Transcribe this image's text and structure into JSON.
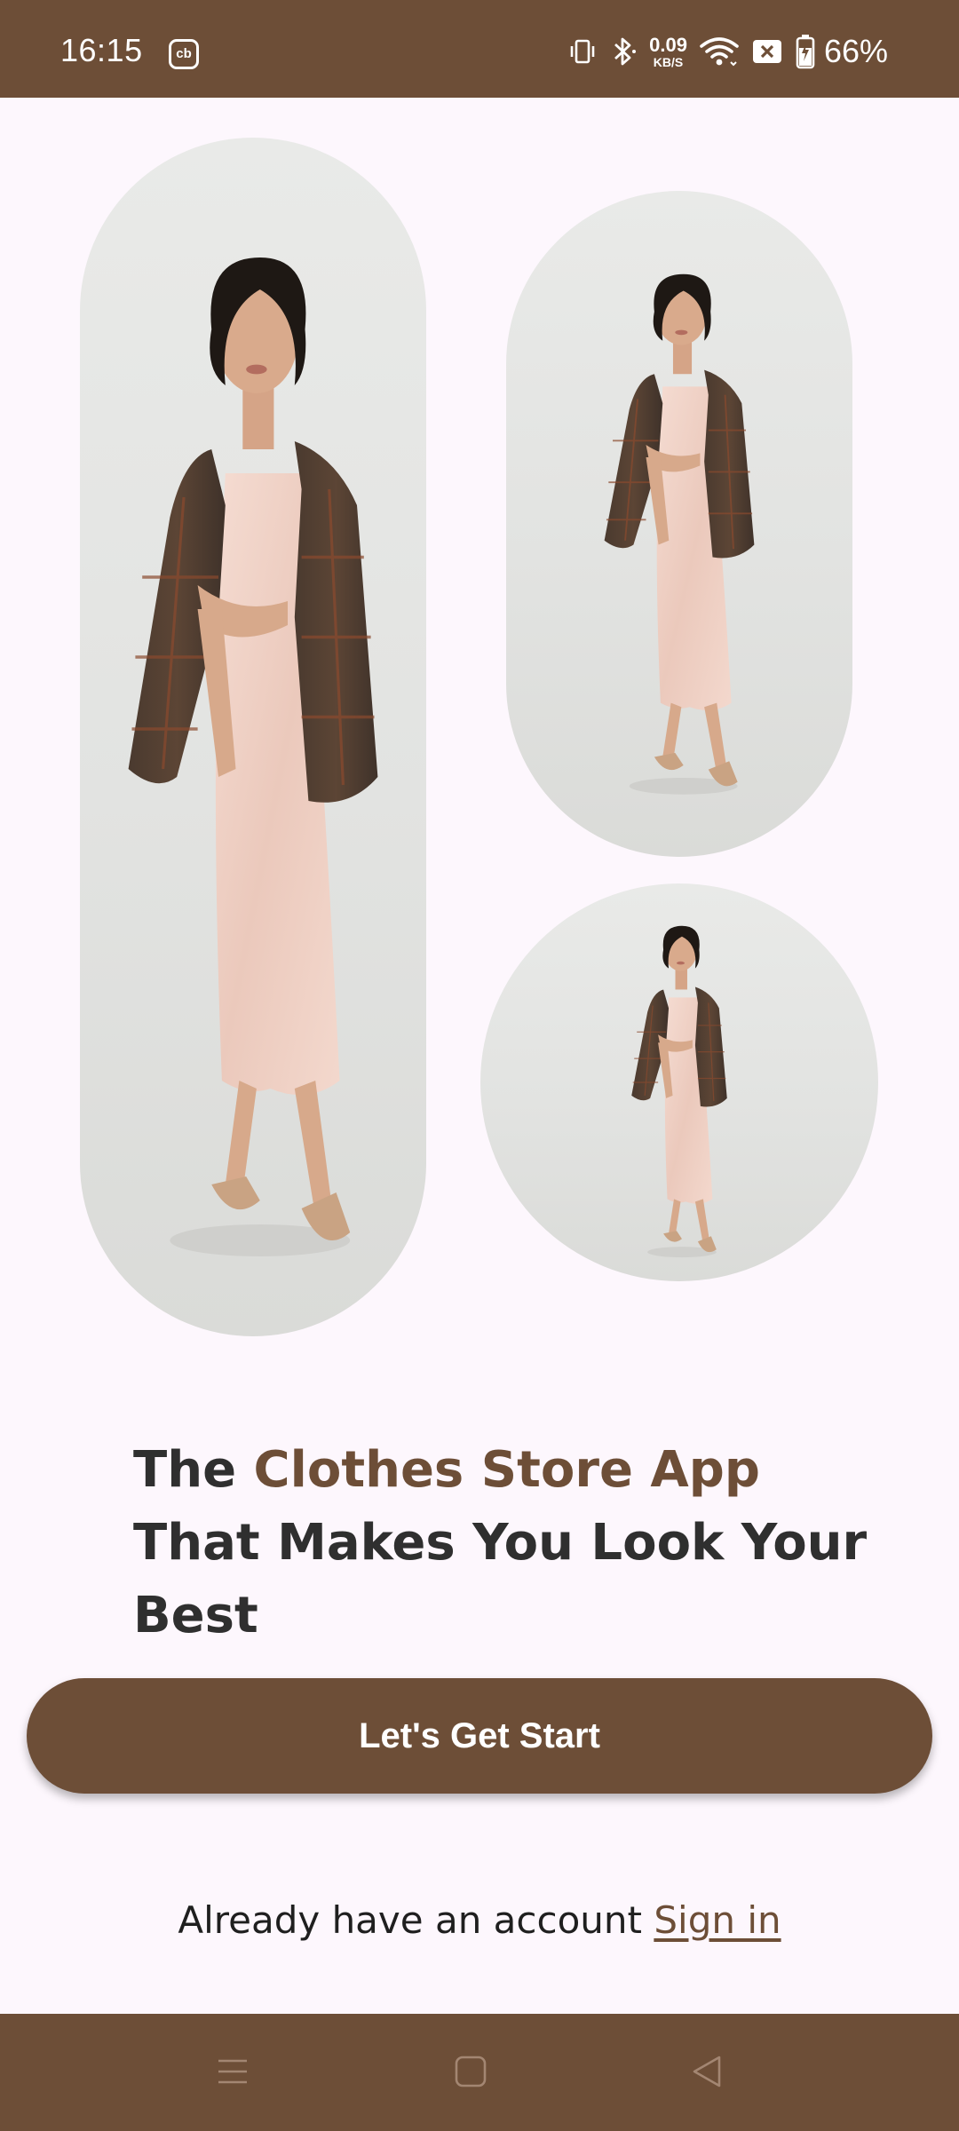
{
  "status_bar": {
    "time": "16:15",
    "app_badge": "cb",
    "net_speed_value": "0.09",
    "net_speed_unit": "KB/S",
    "battery_percent": "66%",
    "icons": [
      "vibrate-icon",
      "bluetooth-icon",
      "wifi-icon",
      "sim-off-icon",
      "battery-charging-icon"
    ]
  },
  "gallery": {
    "images": [
      {
        "name": "model-photo-tall",
        "subject": "woman in blush slip dress with plaid blazer"
      },
      {
        "name": "model-photo-pill",
        "subject": "woman in blush slip dress with plaid blazer"
      },
      {
        "name": "model-photo-circle",
        "subject": "woman in blush slip dress with plaid blazer"
      }
    ]
  },
  "headline": {
    "prefix": "The ",
    "highlight": "Clothes Store App",
    "suffix": " That Makes You Look Your Best"
  },
  "cta": {
    "label": "Let's Get Start"
  },
  "signin": {
    "prompt": "Already have an account ",
    "link": "Sign in"
  },
  "nav_bar": {
    "buttons": [
      "menu-icon",
      "home-icon",
      "back-icon"
    ]
  },
  "colors": {
    "brand": "#6D4E37",
    "background": "#FDF7FD",
    "text": "#2F2F2F",
    "photo_backdrop": "#E6E7E5"
  }
}
